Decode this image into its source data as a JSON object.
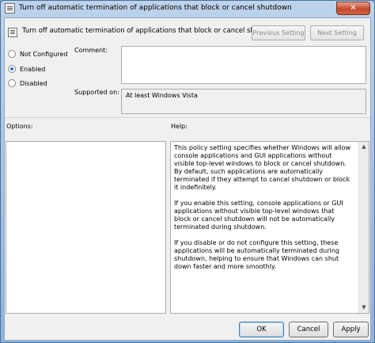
{
  "window": {
    "title": "Turn off automatic termination of applications that block or cancel shutdown",
    "close_label": "✕"
  },
  "header": {
    "title": "Turn off automatic termination of applications that block or cancel shutdown",
    "prev_label": "Previous Setting",
    "next_label": "Next Setting"
  },
  "state": {
    "options": [
      {
        "label": "Not Configured",
        "selected": false
      },
      {
        "label": "Enabled",
        "selected": true
      },
      {
        "label": "Disabled",
        "selected": false
      }
    ]
  },
  "comment": {
    "label": "Comment:",
    "value": ""
  },
  "supported": {
    "label": "Supported on:",
    "value": "At least Windows Vista"
  },
  "options_label": "Options:",
  "help": {
    "label": "Help:",
    "paragraphs": [
      "This policy setting specifies whether Windows will allow console applications and GUI applications without visible top-level windows to block or cancel shutdown. By default, such applications are automatically terminated if they attempt to cancel shutdown or block it indefinitely.",
      "If you enable this setting, console applications or GUI applications without visible top-level windows that block or cancel shutdown will not be automatically terminated during shutdown.",
      "If you disable or do not configure this setting, these applications will be automatically terminated during shutdown, helping to ensure that Windows can shut down faster and more smoothly."
    ]
  },
  "buttons": {
    "ok": "OK",
    "cancel": "Cancel",
    "apply": "Apply"
  },
  "colors": {
    "accent": "#2a6fbd",
    "close": "#c44a2f"
  }
}
